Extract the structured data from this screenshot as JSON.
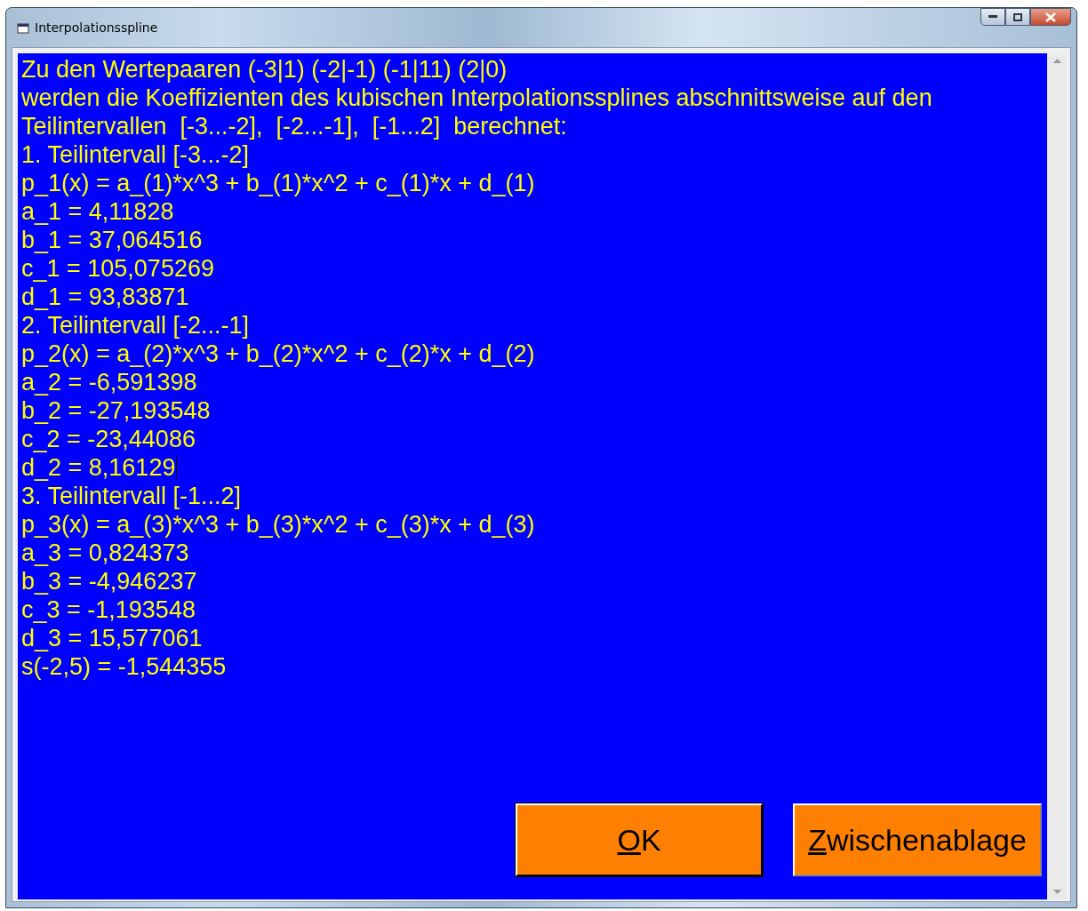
{
  "window": {
    "title": "Interpolationsspline"
  },
  "output": {
    "lines": [
      {
        "text": "Zu den Wertepaaren (-3|1) (-2|-1) (-1|11) (2|0)",
        "caret": false
      },
      {
        "text": "werden die Koeffizienten des kubischen Interpolationssplines abschnittsweise auf den",
        "caret": false
      },
      {
        "text": "Teilintervallen  [-3...-2],  [-2...-1],  [-1...2]  berechnet:",
        "caret": false
      },
      {
        "text": "1. Teilintervall [-3...-2]",
        "caret": false
      },
      {
        "text": "p_1(x) = a_(1)*x^3 + b_(1)*x^2 + c_(1)*x + d_(1)",
        "caret": false
      },
      {
        "text": "a_1 = 4,11828",
        "caret": false
      },
      {
        "text": "b_1 = 37,064516",
        "caret": false
      },
      {
        "text": "c_1 = 105,075269",
        "caret": false
      },
      {
        "text": "d_1 = 93,83871",
        "caret": false
      },
      {
        "text": "2. Teilintervall [-2...-1]",
        "caret": false
      },
      {
        "text": "p_2(x) = a_(2)*x^3 + b_(2)*x^2 + c_(2)*x + d_(2)",
        "caret": false
      },
      {
        "text": "a_2 = -6,591398",
        "caret": false
      },
      {
        "text": "b_2 = -27,193548",
        "caret": false
      },
      {
        "text": "c_2 = -23,44086",
        "caret": false
      },
      {
        "text": "d_2 = 8,16129",
        "caret": true
      },
      {
        "text": "3. Teilintervall [-1...2]",
        "caret": false
      },
      {
        "text": "p_3(x) = a_(3)*x^3 + b_(3)*x^2 + c_(3)*x + d_(3)",
        "caret": false
      },
      {
        "text": "a_3 = 0,824373",
        "caret": false
      },
      {
        "text": "b_3 = -4,946237",
        "caret": false
      },
      {
        "text": "c_3 = -1,193548",
        "caret": false
      },
      {
        "text": "d_3 = 15,577061",
        "caret": false
      },
      {
        "text": "s(-2,5) = -1,544355",
        "caret": false
      }
    ]
  },
  "buttons": [
    {
      "label": "OK",
      "underline_first": true,
      "default": true
    },
    {
      "label": "Zwischenablage",
      "underline_first": true,
      "default": false
    }
  ]
}
